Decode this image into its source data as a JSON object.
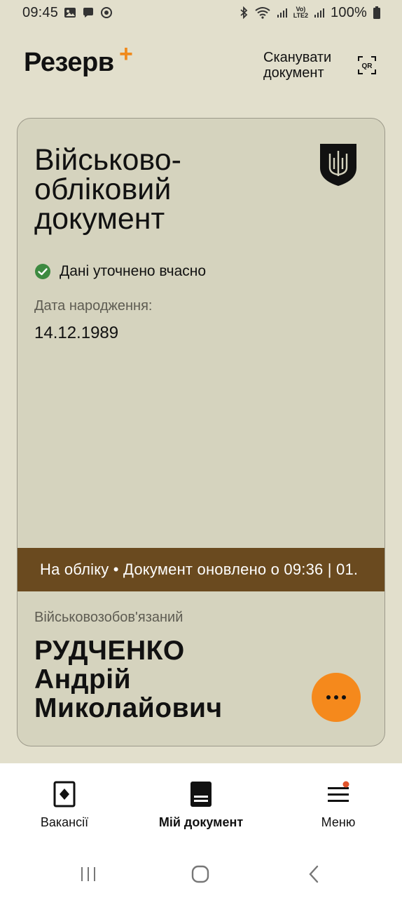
{
  "status_bar": {
    "time": "09:45",
    "battery": "100%",
    "lte_top": "Vo)",
    "lte_bottom": "LTE2"
  },
  "header": {
    "logo": "Резерв",
    "logo_plus": "+",
    "scan_label": "Сканувати\nдокумент",
    "qr_text": "QR"
  },
  "card": {
    "title": "Військово-\nобліковий\nдокумент",
    "status_text": "Дані уточнено вчасно",
    "dob_label": "Дата народження:",
    "dob_value": "14.12.1989",
    "ticker": "На обліку • Документ оновлено о 09:36 | 01.",
    "role": "Військовозобов'язаний",
    "name": "РУДЧЕНКО\nАндрій\nМиколайович"
  },
  "nav": {
    "items": [
      {
        "label": "Вакансії"
      },
      {
        "label": "Мій документ"
      },
      {
        "label": "Меню"
      }
    ]
  },
  "colors": {
    "background": "#e2dfcc",
    "card": "#d5d3be",
    "accent": "#f5891c",
    "ticker": "#6a4a1f",
    "success": "#3d8a41"
  }
}
